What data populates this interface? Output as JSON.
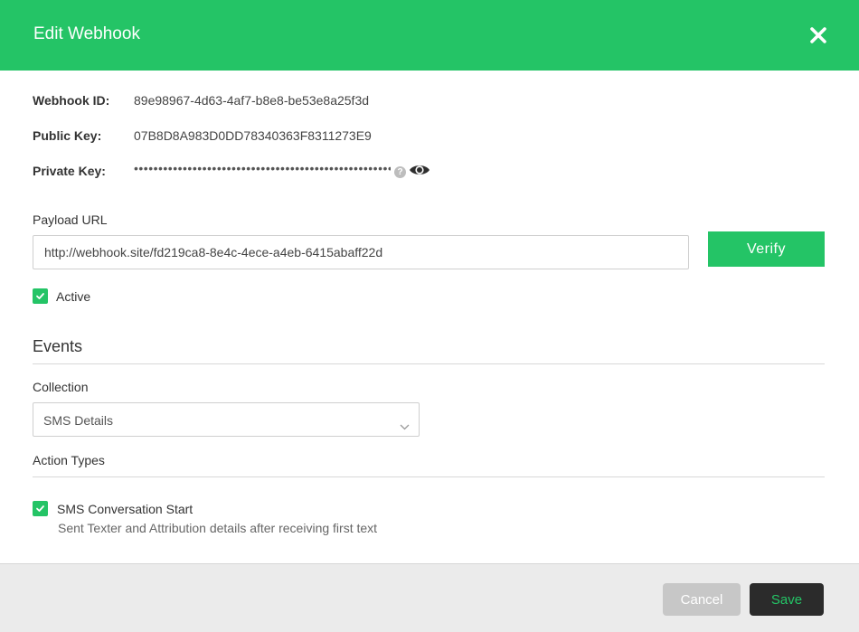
{
  "dialog": {
    "title": "Edit Webhook",
    "close_icon": "close-icon"
  },
  "details": {
    "webhook_id_label": "Webhook ID:",
    "webhook_id_value": "89e98967-4d63-4af7-b8e8-be53e8a25f3d",
    "public_key_label": "Public Key:",
    "public_key_value": "07B8D8A983D0DD78340363F8311273E9",
    "private_key_label": "Private Key:",
    "private_key_masked": "••••••••••••••••••••••••••••••••••••••••••••••••••••••••••••••••",
    "help_icon": "question-icon",
    "reveal_icon": "eye-icon"
  },
  "payload": {
    "label": "Payload URL",
    "url_value": "http://webhook.site/fd219ca8-8e4c-4ece-a4eb-6415abaff22d",
    "verify_label": "Verify",
    "active_label": "Active",
    "active_checked": true
  },
  "events": {
    "title": "Events",
    "collection_label": "Collection",
    "collection_value": "SMS Details",
    "action_types_label": "Action Types",
    "actions": [
      {
        "label": "SMS Conversation Start",
        "description": "Sent Texter and Attribution details after receiving first text",
        "checked": true
      }
    ]
  },
  "footer": {
    "cancel_label": "Cancel",
    "save_label": "Save"
  },
  "colors": {
    "accent": "#24c466",
    "header_text": "#ffffff",
    "save_bg": "#2b2b2b",
    "cancel_bg": "#c7c7c7"
  }
}
